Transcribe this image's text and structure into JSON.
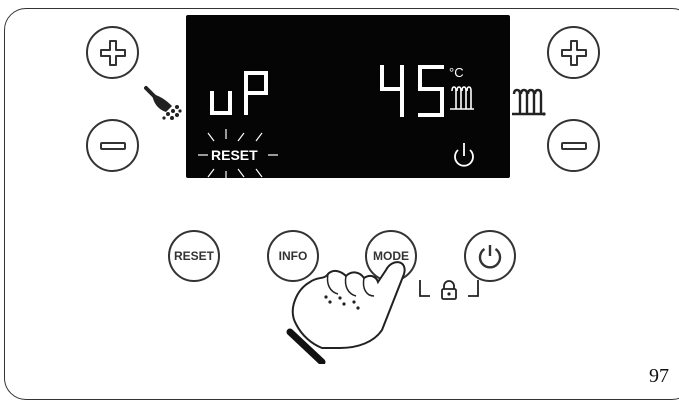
{
  "left_controls": {
    "plus_icon": "plus-icon",
    "minus_icon": "minus-icon",
    "function_icon": "shower-tap-icon"
  },
  "right_controls": {
    "plus_icon": "plus-icon",
    "minus_icon": "minus-icon",
    "function_icon": "radiator-icon"
  },
  "display": {
    "mode_text": "uP",
    "temperature": "45",
    "unit": "°C",
    "reset_label": "RESET",
    "power_icon": "power-icon"
  },
  "buttons": {
    "reset": "RESET",
    "info": "INFO",
    "mode": "MODE",
    "power_icon": "power-icon",
    "lock_icon": "padlock-icon"
  },
  "gesture_icon": "pointing-hand-icon",
  "page_number": "97"
}
